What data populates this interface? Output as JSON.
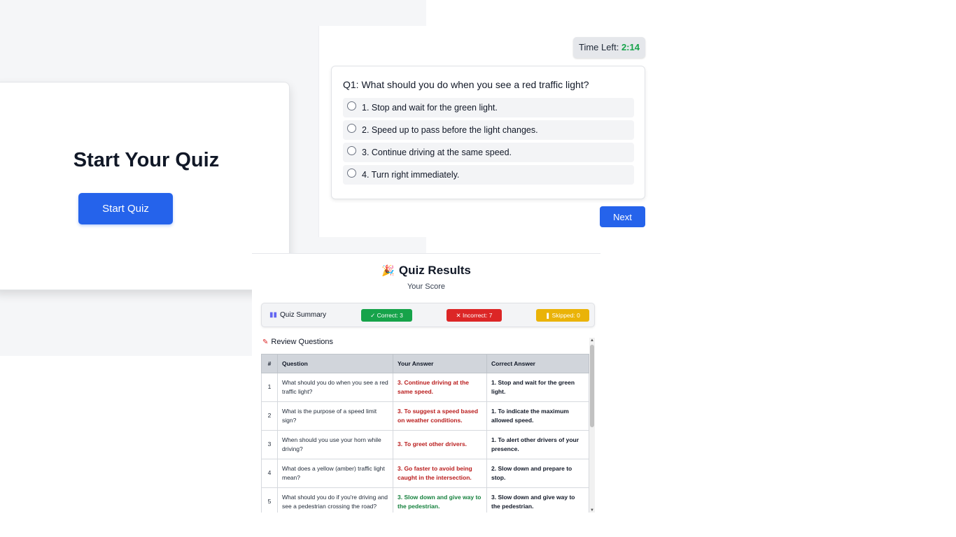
{
  "start": {
    "title": "Start Your Quiz",
    "button_label": "Start Quiz"
  },
  "quiz": {
    "timer_label": "Time Left:",
    "timer_value": "2:14",
    "question": "Q1: What should you do when you see a red traffic light?",
    "options": [
      "1. Stop and wait for the green light.",
      "2. Speed up to pass before the light changes.",
      "3. Continue driving at the same speed.",
      "4. Turn right immediately."
    ],
    "next_label": "Next"
  },
  "results": {
    "title": "Quiz Results",
    "subtitle": "Your Score",
    "summary_label": "Quiz Summary",
    "correct_label": "Correct: 3",
    "incorrect_label": "Incorrect: 7",
    "skipped_label": "Skipped: 0",
    "review_label": "Review Questions",
    "columns": [
      "#",
      "Question",
      "Your Answer",
      "Correct Answer"
    ],
    "rows": [
      {
        "num": "1",
        "question": "What should you do when you see a red traffic light?",
        "your": "3. Continue driving at the same speed.",
        "correct": "1. Stop and wait for the green light.",
        "is_correct": false
      },
      {
        "num": "2",
        "question": "What is the purpose of a speed limit sign?",
        "your": "3. To suggest a speed based on weather conditions.",
        "correct": "1. To indicate the maximum allowed speed.",
        "is_correct": false
      },
      {
        "num": "3",
        "question": "When should you use your horn while driving?",
        "your": "3. To greet other drivers.",
        "correct": "1. To alert other drivers of your presence.",
        "is_correct": false
      },
      {
        "num": "4",
        "question": "What does a yellow (amber) traffic light mean?",
        "your": "3. Go faster to avoid being caught in the intersection.",
        "correct": "2. Slow down and prepare to stop.",
        "is_correct": false
      },
      {
        "num": "5",
        "question": "What should you do if you're driving and see a pedestrian crossing the road?",
        "your": "3. Slow down and give way to the pedestrian.",
        "correct": "3. Slow down and give way to the pedestrian.",
        "is_correct": true
      }
    ]
  },
  "colors": {
    "primary": "#2563eb",
    "correct": "#16a34a",
    "incorrect": "#dc2626",
    "skipped": "#eab308"
  }
}
